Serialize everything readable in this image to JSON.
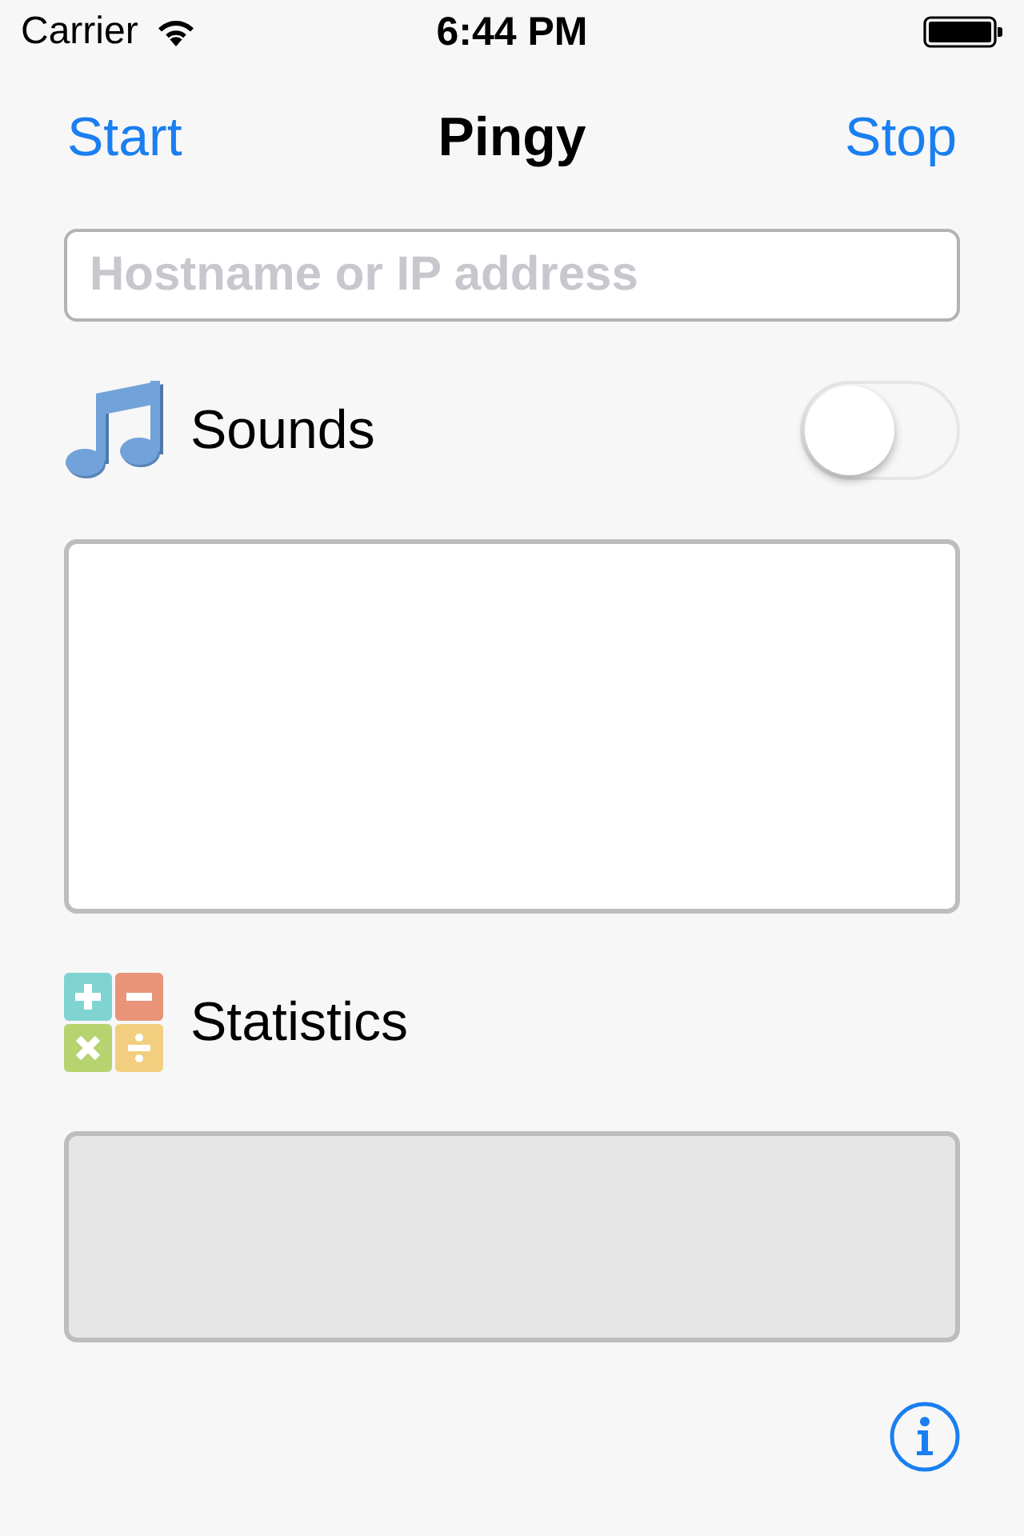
{
  "status_bar": {
    "carrier": "Carrier",
    "time": "6:44 PM"
  },
  "nav_bar": {
    "left_button": "Start",
    "title": "Pingy",
    "right_button": "Stop"
  },
  "host_field": {
    "placeholder": "Hostname or IP address"
  },
  "sounds": {
    "label": "Sounds",
    "on": false
  },
  "statistics": {
    "label": "Statistics"
  }
}
